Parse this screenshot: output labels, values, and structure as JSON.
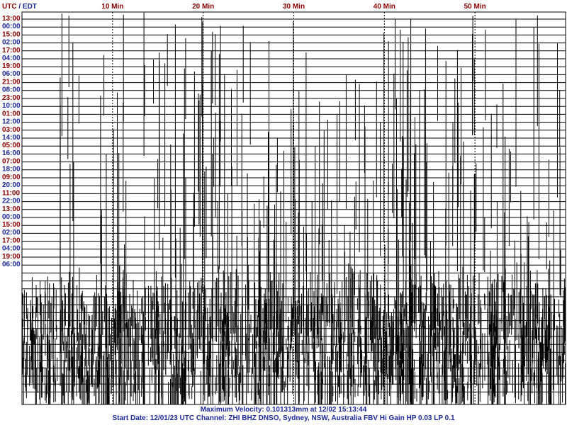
{
  "chart_data": {
    "type": "line",
    "header": {
      "timezone_label_utc": "UTC",
      "timezone_separator": " / ",
      "timezone_label_local": "EDT"
    },
    "x_axis": {
      "unit": "minutes",
      "range": [
        0,
        60
      ],
      "ticks": [
        {
          "value": 10,
          "label": "10 Min"
        },
        {
          "value": 20,
          "label": "20 Min"
        },
        {
          "value": 30,
          "label": "30 Min"
        },
        {
          "value": 40,
          "label": "40 Min"
        },
        {
          "value": 50,
          "label": "50 Min"
        }
      ]
    },
    "rows_total": 24,
    "row_labels": [
      {
        "row": 0,
        "utc": "13:00",
        "local": "00:00"
      },
      {
        "row": 2,
        "utc": "15:00",
        "local": "02:00"
      },
      {
        "row": 4,
        "utc": "17:00",
        "local": "04:00"
      },
      {
        "row": 6,
        "utc": "19:00",
        "local": "06:00"
      },
      {
        "row": 8,
        "utc": "21:00",
        "local": "08:00"
      },
      {
        "row": 10,
        "utc": "23:00",
        "local": "10:00"
      },
      {
        "row": 12,
        "utc": "01:00",
        "local": "12:00"
      },
      {
        "row": 14,
        "utc": "03:00",
        "local": "14:00"
      },
      {
        "row": 16,
        "utc": "05:00",
        "local": "16:00"
      },
      {
        "row": 18,
        "utc": "07:00",
        "local": "18:00"
      },
      {
        "row": 20,
        "utc": "09:00",
        "local": "20:00"
      },
      {
        "row": 22,
        "utc": "11:00",
        "local": "22:00"
      },
      {
        "row": 24,
        "utc": "13:00",
        "local": "00:00"
      },
      {
        "row": 26,
        "utc": "15:00",
        "local": "02:00"
      },
      {
        "row": 28,
        "utc": "17:00",
        "local": "04:00"
      },
      {
        "row": 30,
        "utc": "19:00",
        "local": "06:00"
      }
    ],
    "colors": {
      "utc_label": "#8b0000",
      "local_label": "#1e2a9b",
      "trace": "#000000",
      "grid": "#000000",
      "footer": "#1e2a9b"
    },
    "grid": true,
    "footer": {
      "line1": "Maximum Velocity: 0.101313mm at 12/02 15:13:44",
      "line2": "Start Date: 12/01/23 UTC Channel: ZHI  BHZ  DNSO, Sydney, NSW, Australia  FBV Hi Gain HP 0.03  LP 0.1"
    }
  }
}
